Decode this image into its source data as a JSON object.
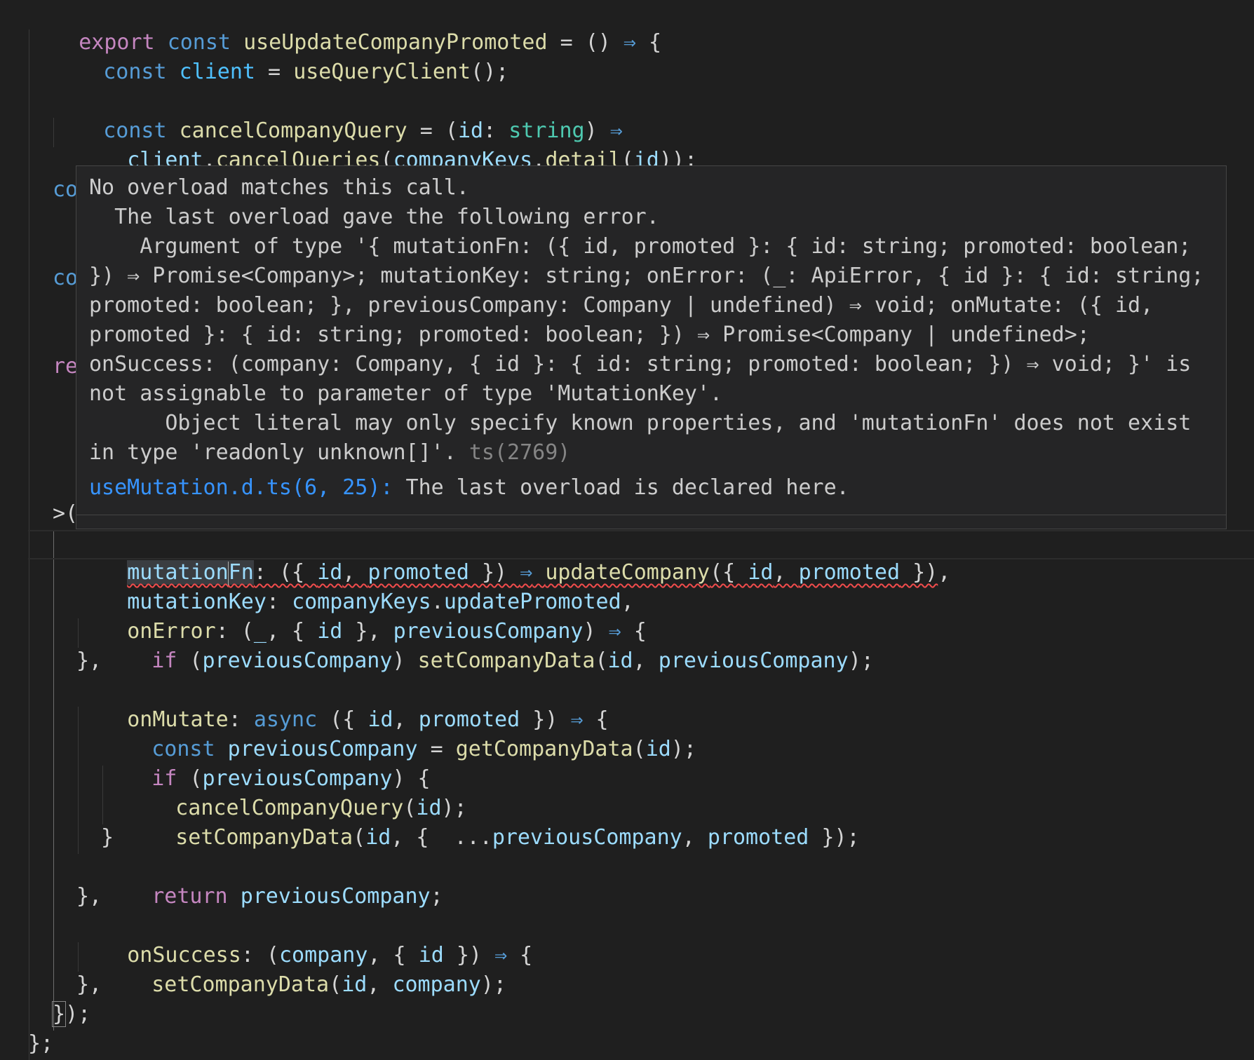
{
  "editor": {
    "code_lines": [
      "export const useUpdateCompanyPromoted = () => {",
      "const client = useQueryClient();",
      "const cancelCompanyQuery = (id: string) =>",
      "client.cancelQueries(companyKeys.detail(id));",
      "mutationFn: ({ id, promoted }) => updateCompany({ id, promoted }),",
      "mutationKey: companyKeys.updatePromoted,",
      "onError: (_, { id }, previousCompany) => {",
      "if (previousCompany) setCompanyData(id, previousCompany);",
      "},",
      "onMutate: async ({ id, promoted }) => {",
      "const previousCompany = getCompanyData(id);",
      "if (previousCompany) {",
      "cancelCompanyQuery(id);",
      "setCompanyData(id, { ...previousCompany, promoted });",
      "}",
      "return previousCompany;",
      "},",
      "onSuccess: (company, { id }) => {",
      "setCompanyData(id, company);",
      "},",
      "});",
      "};"
    ],
    "hidden_fragments": [
      "co",
      "co",
      "re",
      ">("
    ]
  },
  "hover": {
    "message": "No overload matches this call.\n  The last overload gave the following error.\n    Argument of type '{ mutationFn: ({ id, promoted }: { id: string; promoted: boolean; }) => Promise<Company>; mutationKey: string; onError: (_: ApiError, { id }: { id: string; promoted: boolean; }, previousCompany: Company | undefined) => void; onMutate: ({ id, promoted }: { id: string; promoted: boolean; }) => Promise<Company | undefined>; onSuccess: (company: Company, { id }: { id: string; promoted: boolean; }) => void; }' is not assignable to parameter of type 'MutationKey'.\n      Object literal may only specify known properties, and 'mutationFn' does not exist in type 'readonly unknown[]'.",
    "code": "ts(2769)",
    "related_link": "useMutation.d.ts(6, 25):",
    "related_text": " The last overload is declared here."
  },
  "colors": {
    "background": "#1f1f1f",
    "keyword": "#c586c0",
    "storage": "#569cd6",
    "function": "#dcdcaa",
    "variable": "#9cdcfe",
    "constant": "#4fc1ff",
    "type": "#4ec9b0",
    "error": "#f14c4c",
    "hover_bg": "#252526"
  }
}
